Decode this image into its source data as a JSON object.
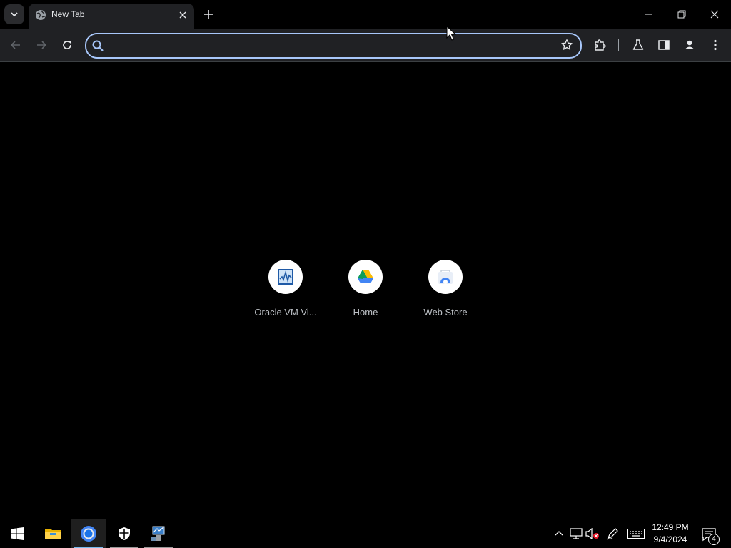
{
  "browser": {
    "tab": {
      "title": "New Tab",
      "favicon": "globe-icon"
    },
    "window_controls": [
      "minimize-icon",
      "restore-icon",
      "close-icon"
    ],
    "omnibox": {
      "value": "",
      "placeholder": ""
    },
    "toolbar_icons": [
      "back-icon",
      "forward-icon",
      "reload-icon",
      "bookmark-star-icon",
      "extensions-icon",
      "labs-flask-icon",
      "side-panel-icon",
      "profile-icon",
      "menu-icon"
    ],
    "accent": "#a8c7fa"
  },
  "shortcuts": [
    {
      "label": "Oracle VM Vi...",
      "icon": "virtualbox-icon"
    },
    {
      "label": "Home",
      "icon": "google-drive-icon"
    },
    {
      "label": "Web Store",
      "icon": "chrome-web-store-icon"
    }
  ],
  "taskbar": {
    "apps": [
      "windows-start-icon",
      "file-explorer-icon",
      "chrome-icon",
      "security-shield-icon",
      "server-manager-icon"
    ],
    "tray": [
      "chevron-up-icon",
      "network-icon",
      "volume-muted-icon",
      "pen-icon",
      "keyboard-icon"
    ],
    "time": "12:49 PM",
    "date": "9/4/2024",
    "notification_count": "4"
  }
}
